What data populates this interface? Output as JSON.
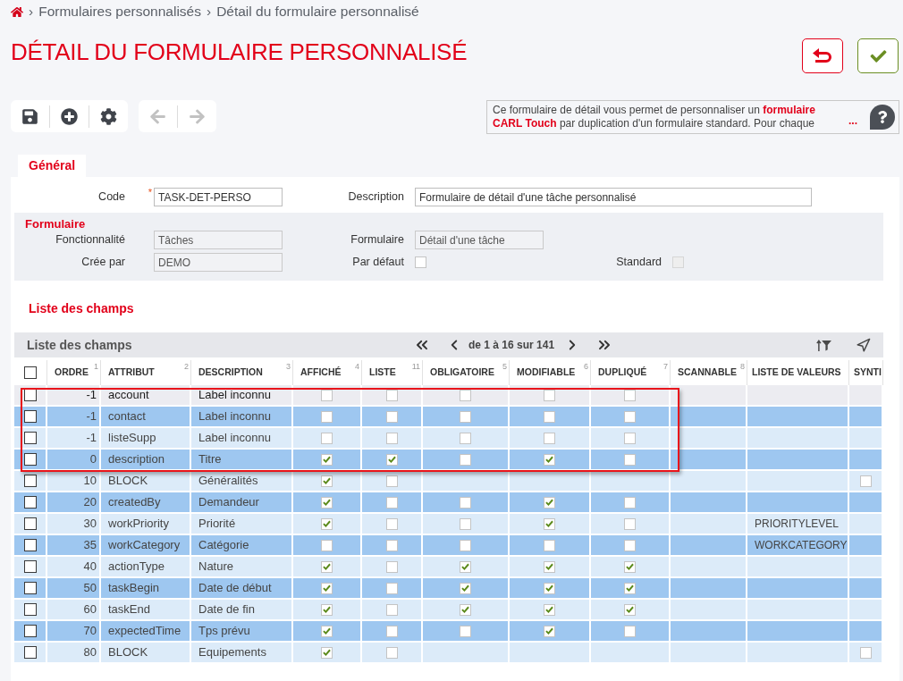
{
  "breadcrumb": [
    {
      "separator": "›",
      "label": "Formulaires personnalisés"
    },
    {
      "separator": "›",
      "label": "Détail du formulaire personnalisé"
    }
  ],
  "page_title": "DÉTAIL DU FORMULAIRE PERSONNALISÉ",
  "toolbar": {
    "groups": [
      {
        "tools": [
          {
            "kind": "save",
            "disabled": false
          },
          {
            "kind": "add",
            "disabled": false
          },
          {
            "kind": "settings",
            "disabled": false
          }
        ]
      },
      {
        "tools": [
          {
            "kind": "back",
            "disabled": true
          },
          {
            "kind": "forward",
            "disabled": true
          }
        ]
      }
    ]
  },
  "help_box": {
    "text": "Ce formulaire de détail vous permet de personnaliser un **formulaire CARL Touch** par duplication d'un formulaire standard. Pour chaque",
    "more": "..."
  },
  "tabs": [
    {
      "label": "Général",
      "selected": true
    }
  ],
  "general": {
    "code": {
      "label": "Code",
      "required_mark": "*",
      "value": "TASK-DET-PERSO"
    },
    "description": {
      "label": "Description",
      "value": "Formulaire de détail d'une tâche personnalisé"
    }
  },
  "formulaire": {
    "title": "Formulaire",
    "fonctionnalite": {
      "label": "Fonctionnalité",
      "value": "Tâches"
    },
    "formulaire": {
      "label": "Formulaire",
      "value": "Détail d'une tâche"
    },
    "cree_par": {
      "label": "Crée par",
      "value": "DEMO"
    },
    "par_defaut": {
      "label": "Par défaut",
      "checked": false,
      "disabled": false
    },
    "standard": {
      "label": "Standard",
      "checked": false,
      "disabled": true
    }
  },
  "section_title": "Liste des champs",
  "table": {
    "title": "Liste des champs",
    "pagination": {
      "range": "de 1 à 16 sur 141"
    },
    "header_checkbox": {
      "checked": false
    },
    "columns": [
      {
        "label": "ORDRE",
        "sort": "1"
      },
      {
        "label": "ATTRIBUT",
        "sort": "2"
      },
      {
        "label": "DESCRIPTION",
        "sort": "3"
      },
      {
        "label": "AFFICHÉ",
        "sort": "4"
      },
      {
        "label": "LISTE",
        "sort": "11"
      },
      {
        "label": "OBLIGATOIRE",
        "sort": "5"
      },
      {
        "label": "MODIFIABLE",
        "sort": "6"
      },
      {
        "label": "DUPLIQUÉ",
        "sort": "7"
      },
      {
        "label": "SCANNABLE",
        "sort": "8"
      },
      {
        "label": "LISTE DE VALEURS"
      },
      {
        "label": "SYNTI"
      }
    ],
    "rows": [
      {
        "checked": false,
        "hovered": true,
        "framed": true,
        "ordre": "-1",
        "attribut": "account",
        "description": "Label inconnu",
        "affiche": false,
        "liste": false,
        "obligatoire": false,
        "modifiable": false,
        "duplique": false
      },
      {
        "checked": false,
        "hovered": false,
        "framed": true,
        "ordre": "-1",
        "attribut": "contact",
        "description": "Label inconnu",
        "affiche": false,
        "liste": false,
        "obligatoire": false,
        "modifiable": false,
        "duplique": false
      },
      {
        "checked": false,
        "hovered": false,
        "framed": true,
        "ordre": "-1",
        "attribut": "listeSupp",
        "description": "Label inconnu",
        "affiche": false,
        "liste": false,
        "obligatoire": false,
        "modifiable": false,
        "duplique": false
      },
      {
        "checked": false,
        "hovered": false,
        "framed": true,
        "ordre": "0",
        "attribut": "description",
        "description": "Titre",
        "affiche": true,
        "liste": true,
        "obligatoire": false,
        "modifiable": true,
        "duplique": false
      },
      {
        "checked": false,
        "hovered": false,
        "framed": false,
        "ordre": "10",
        "attribut": "BLOCK",
        "description": "Généralités",
        "affiche": true,
        "liste": false,
        "synti": false
      },
      {
        "checked": false,
        "hovered": false,
        "framed": false,
        "ordre": "20",
        "attribut": "createdBy",
        "description": "Demandeur",
        "affiche": true,
        "liste": false,
        "obligatoire": false,
        "modifiable": true,
        "duplique": false
      },
      {
        "checked": false,
        "hovered": false,
        "framed": false,
        "ordre": "30",
        "attribut": "workPriority",
        "description": "Priorité",
        "affiche": true,
        "liste": false,
        "obligatoire": false,
        "modifiable": true,
        "duplique": false,
        "liste_de_valeurs": "PRIORITYLEVEL"
      },
      {
        "checked": false,
        "hovered": false,
        "framed": false,
        "ordre": "35",
        "attribut": "workCategory",
        "description": "Catégorie",
        "affiche": false,
        "liste": false,
        "obligatoire": false,
        "modifiable": false,
        "duplique": false,
        "liste_de_valeurs": "WORKCATEGORY"
      },
      {
        "checked": false,
        "hovered": false,
        "framed": false,
        "ordre": "40",
        "attribut": "actionType",
        "description": "Nature",
        "affiche": true,
        "liste": false,
        "obligatoire": true,
        "modifiable": true,
        "duplique": true
      },
      {
        "checked": false,
        "hovered": false,
        "framed": false,
        "ordre": "50",
        "attribut": "taskBegin",
        "description": "Date de début",
        "affiche": true,
        "liste": false,
        "obligatoire": true,
        "modifiable": true,
        "duplique": true
      },
      {
        "checked": false,
        "hovered": false,
        "framed": false,
        "ordre": "60",
        "attribut": "taskEnd",
        "description": "Date de fin",
        "affiche": true,
        "liste": false,
        "obligatoire": true,
        "modifiable": true,
        "duplique": true
      },
      {
        "checked": false,
        "hovered": false,
        "framed": false,
        "ordre": "70",
        "attribut": "expectedTime",
        "description": "Tps prévu",
        "affiche": true,
        "liste": false,
        "obligatoire": false,
        "modifiable": true,
        "duplique": false
      },
      {
        "checked": false,
        "hovered": false,
        "framed": false,
        "ordre": "80",
        "attribut": "BLOCK",
        "description": "Equipements",
        "affiche": true,
        "liste": false,
        "synti": false
      }
    ]
  }
}
